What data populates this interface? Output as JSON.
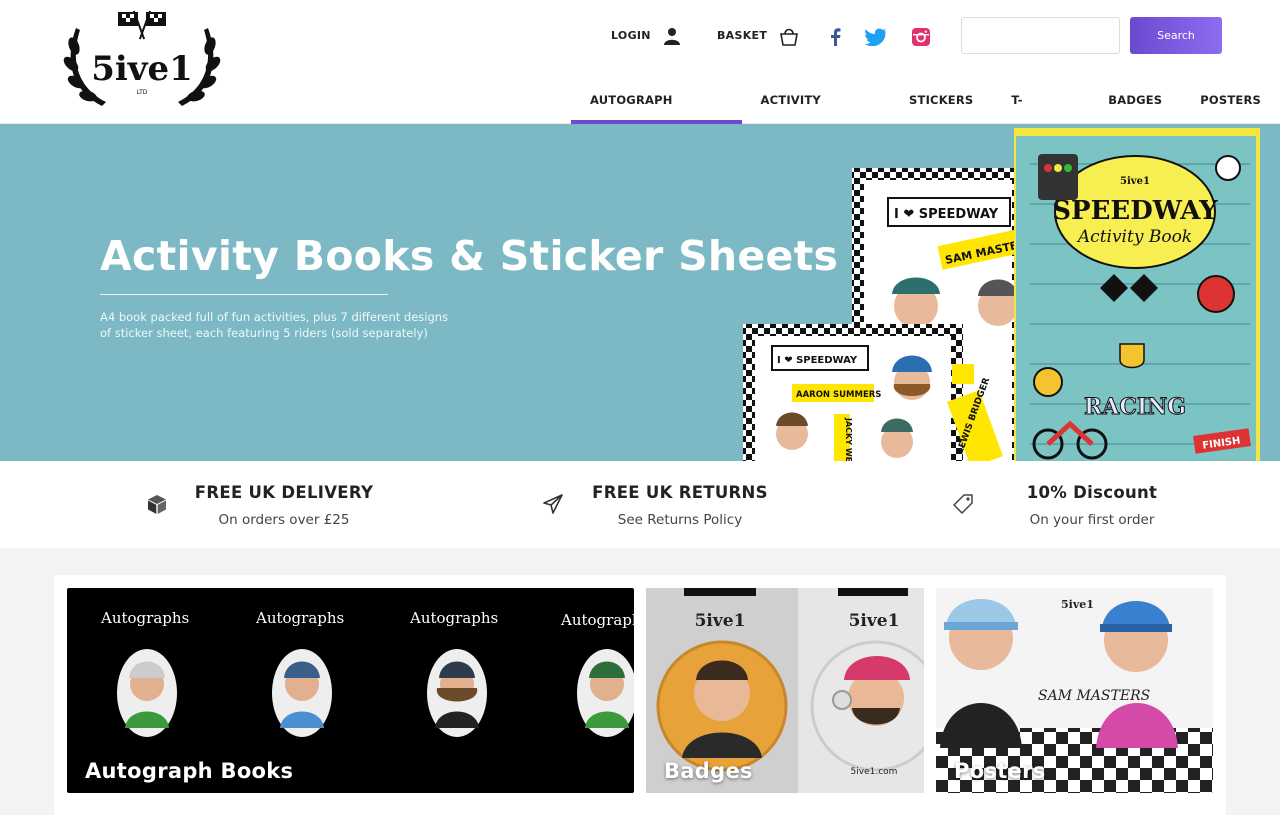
{
  "brand": {
    "logo_text": "5ive1",
    "logo_subtext": "LTD"
  },
  "header": {
    "login_label": "LOGIN",
    "basket_label": "BASKET",
    "social": [
      {
        "icon": "facebook-icon",
        "color": "#3b5998"
      },
      {
        "icon": "twitter-icon",
        "color": "#1da1f2"
      },
      {
        "icon": "instagram-icon",
        "color": "#e1306c"
      }
    ],
    "search": {
      "placeholder": "",
      "button_label": "Search"
    }
  },
  "nav": {
    "items": [
      {
        "label": "AUTOGRAPH BOOKS",
        "active": true
      },
      {
        "label": "ACTIVITY BOOKS",
        "active": false
      },
      {
        "label": "STICKERS",
        "active": false
      },
      {
        "label": "T-SHIRTS",
        "active": false
      },
      {
        "label": "BADGES",
        "active": false
      },
      {
        "label": "POSTERS",
        "active": false
      }
    ]
  },
  "hero": {
    "title": "Activity Books & Sticker Sheets",
    "subtitle": "A4 book packed full of fun activities, plus 7 different designs of sticker sheet, each featuring 5 riders (sold separately)",
    "art": {
      "sticker_heading": "I ❤ SPEEDWAY",
      "sticker_names": [
        "SAM MASTERS",
        "AARON SUMMERS",
        "LEWIS BRIDGER",
        "JACKY WELLS"
      ],
      "book_title": "SPEEDWAY",
      "book_subtitle": "Activity Book",
      "book_badge": "5ive1",
      "book_racing": "RACING",
      "book_finish": "FINISH"
    },
    "background_color": "#7db9c4"
  },
  "features": [
    {
      "icon": "box-icon",
      "title": "FREE UK DELIVERY",
      "subtitle": "On orders over £25"
    },
    {
      "icon": "paper-plane-icon",
      "title": "FREE UK RETURNS",
      "subtitle": "See Returns Policy"
    },
    {
      "icon": "tag-icon",
      "title": "10% Discount",
      "subtitle": "On your first order"
    }
  ],
  "categories": [
    {
      "label": "Autograph Books",
      "tile_text": "Autographs"
    },
    {
      "label": "Badges",
      "tile_text": "5ive1.com"
    },
    {
      "label": "Posters",
      "tile_text": "SAM MASTERS"
    }
  ],
  "colors": {
    "accent": "#6d49cf",
    "hero_bg": "#7db9c4"
  }
}
